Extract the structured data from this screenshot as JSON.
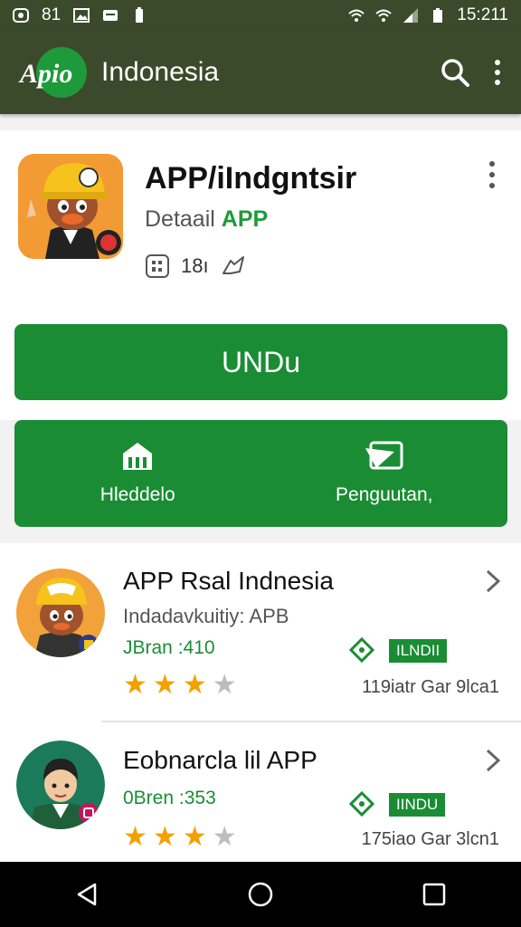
{
  "status": {
    "left_text": "81",
    "time": "15:211"
  },
  "appbar": {
    "title": "Indonesia",
    "logo_text": "Apio"
  },
  "hero": {
    "title": "APP/iIndgntsir",
    "subtitle_prefix": "Detaail ",
    "subtitle_accent": "APP",
    "meta_value": "18ı",
    "install_label": "UNDu"
  },
  "tiles": [
    {
      "label": "Hleddelo"
    },
    {
      "label": "Penguutan,"
    }
  ],
  "list": [
    {
      "title": "APP Rsal Indnesia",
      "subtitle": "Indadavkuitiy: APB",
      "price": "JBran :410",
      "badge": "ILNDII",
      "meta": "119iatr Gar 9lca1",
      "rating": 3
    },
    {
      "title": "Eobnarcla lil APP",
      "subtitle": "",
      "price": "0Bren :353",
      "badge": "IINDU",
      "meta": "175iao Gar 3lcn1",
      "rating": 3
    }
  ],
  "colors": {
    "primary_green": "#1a8d34",
    "appbar": "#3b4a2b",
    "star": "#f2a100"
  }
}
